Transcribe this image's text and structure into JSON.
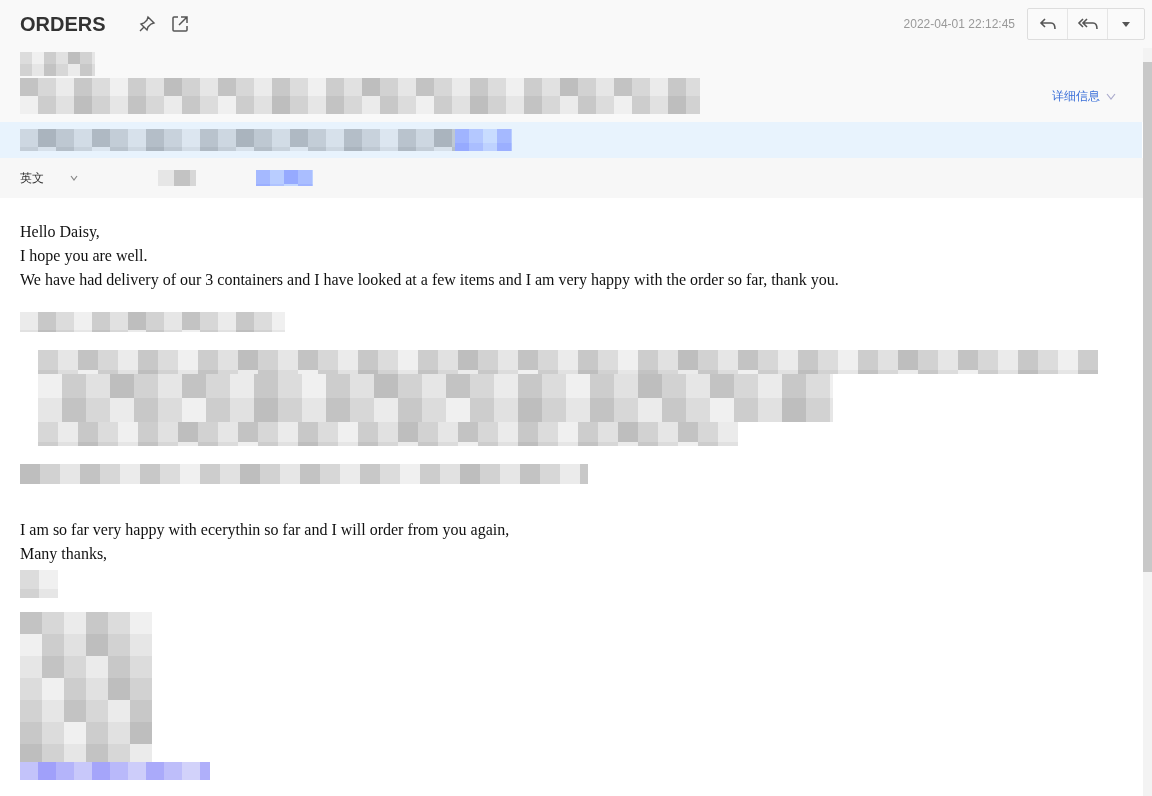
{
  "window": {
    "title": "ORDERS"
  },
  "header": {
    "timestamp": "2022-04-01 22:12:45",
    "details_link": "详细信息",
    "language": "英文"
  },
  "body": {
    "opening": [
      "Hello Daisy,",
      "I hope you are well.",
      "We have had delivery of our 3 containers and I have looked at a few items and I am very happy with the order so far, thank you."
    ],
    "closing": [
      "I am so far very happy with ecerythin so far and I will order from you again,",
      "Many thanks,"
    ]
  }
}
